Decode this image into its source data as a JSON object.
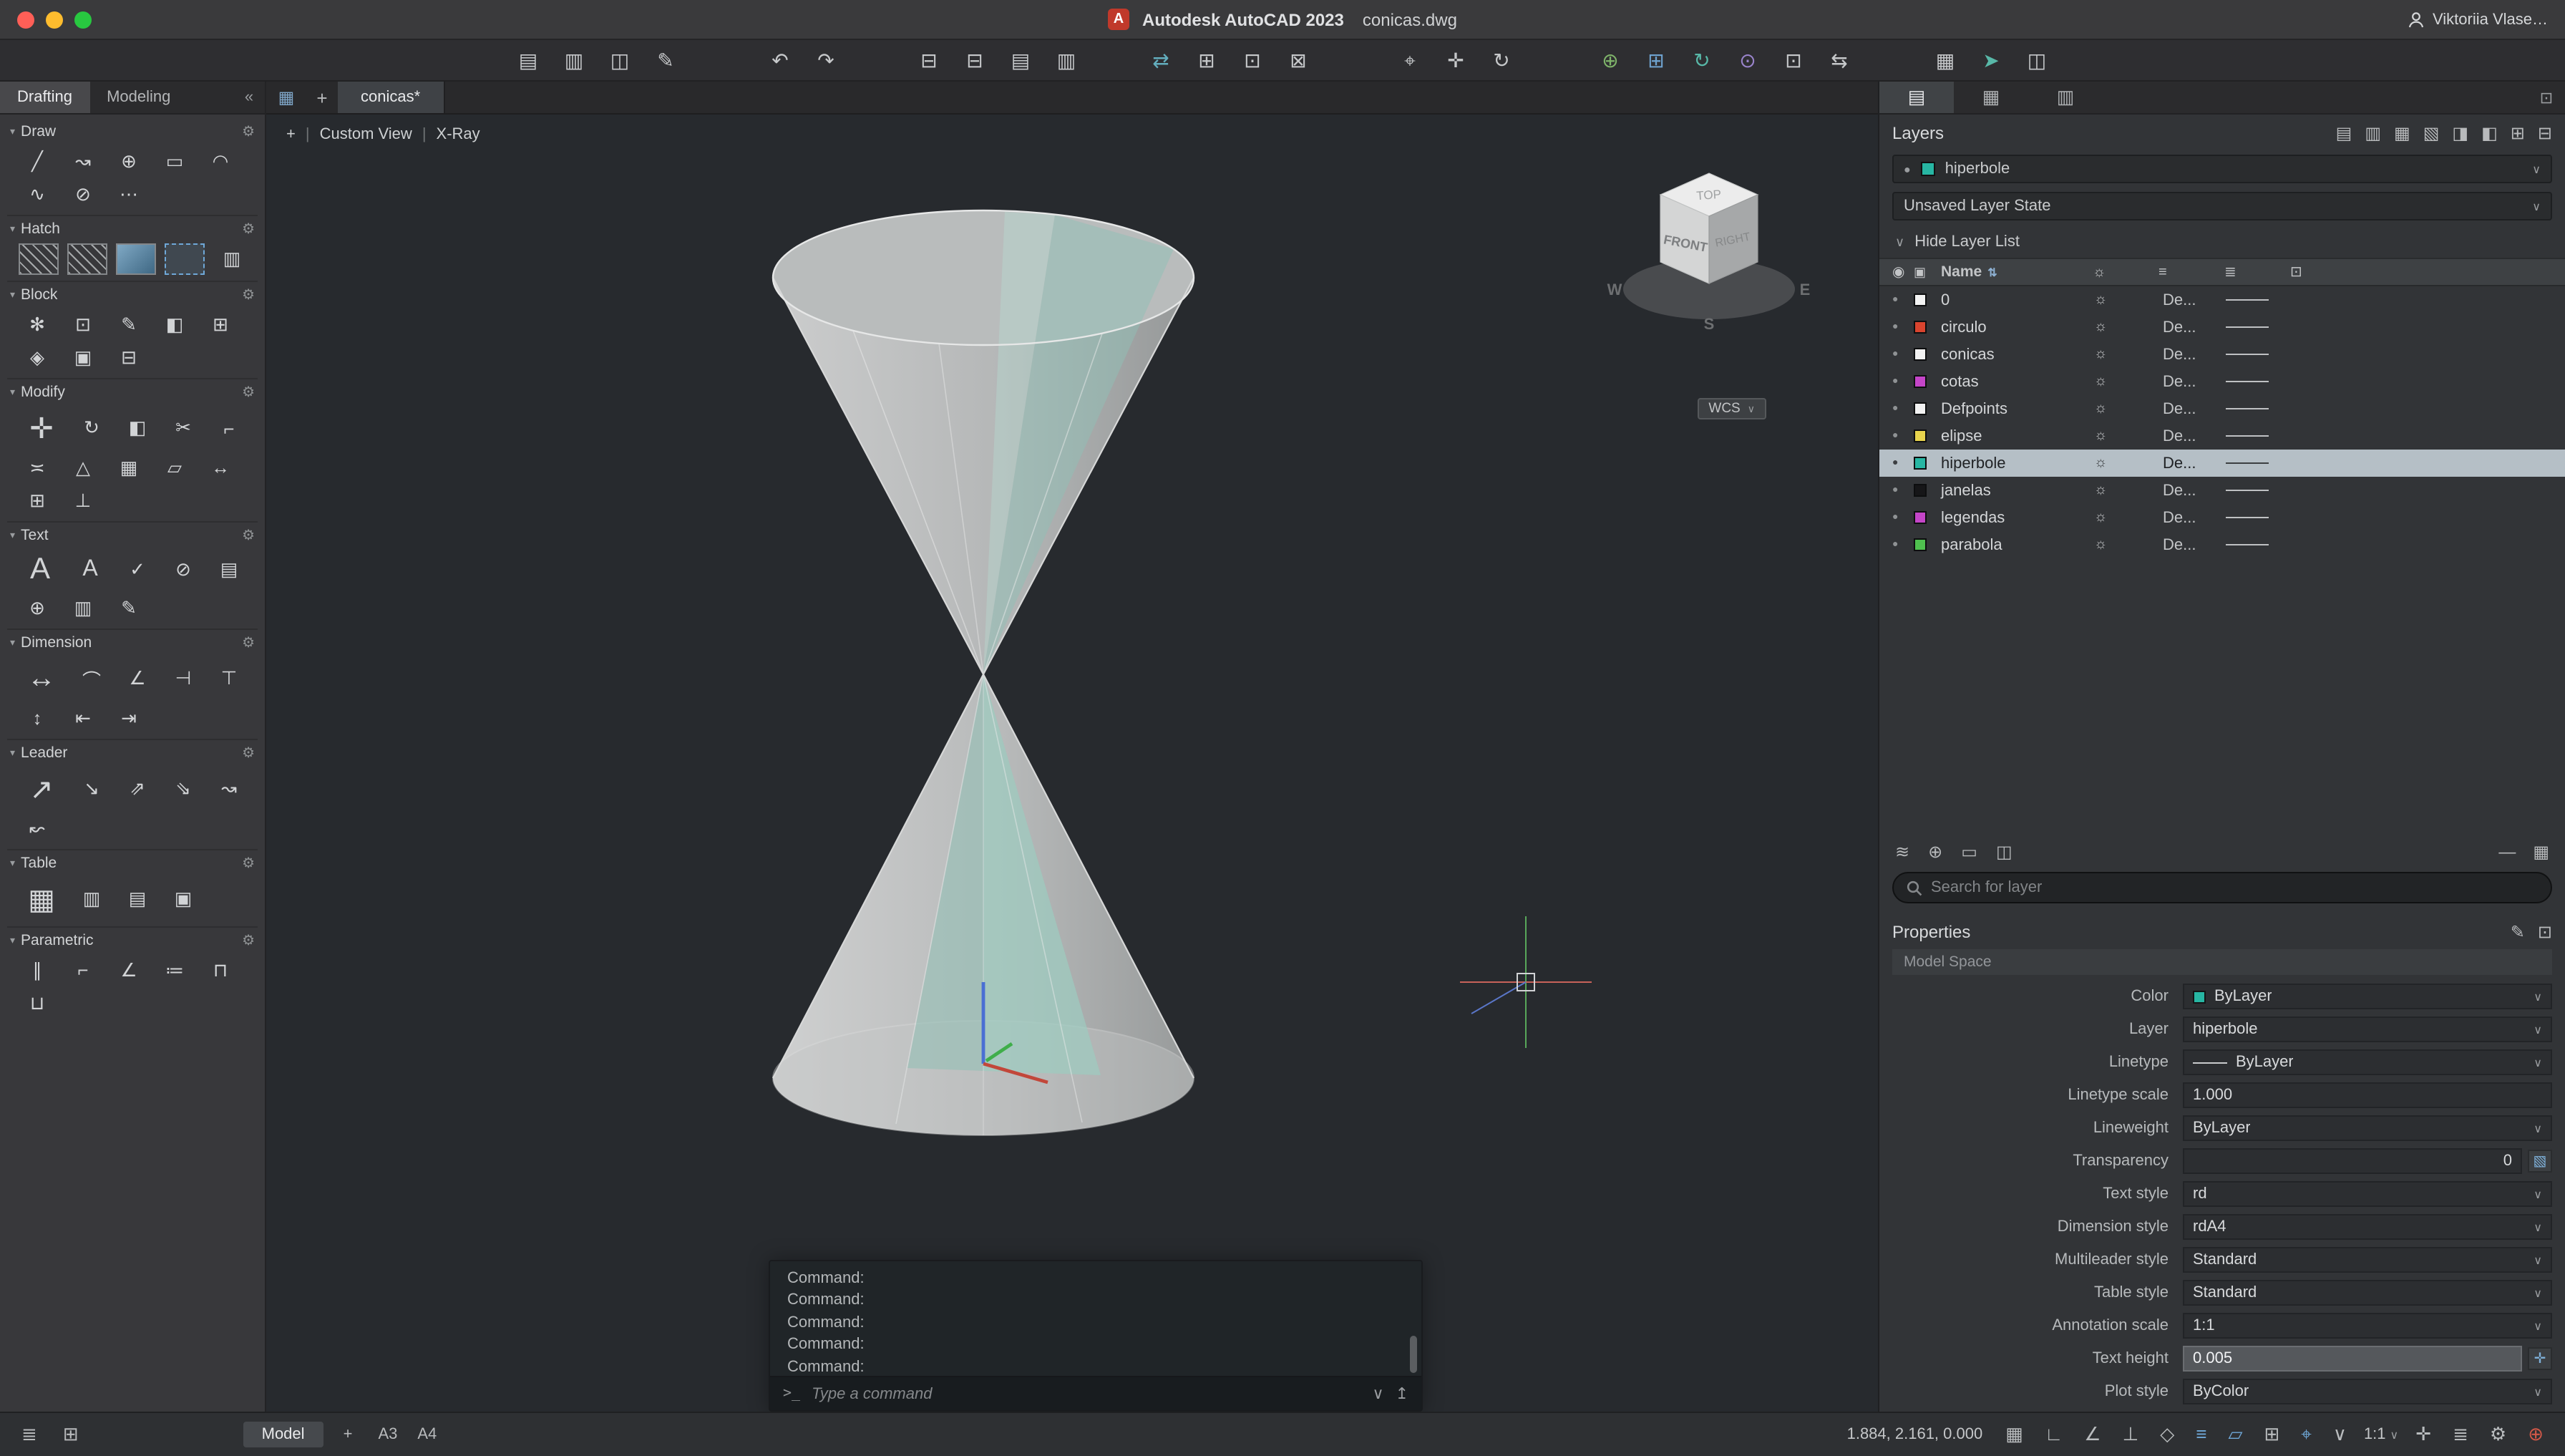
{
  "ui": {
    "arrow": "∨",
    "tri": "▾",
    "gear": "⚙",
    "sep": "|",
    "dot": "●",
    "sun": "☼",
    "eye": "◉",
    "cbox": "▣",
    "sort": "⇅",
    "minus": "—",
    "colgrid": "▦",
    "hist_arrow": "∨",
    "share": "↥",
    "scroll_thumb": ""
  },
  "titlebar": {
    "app_title": "Autodesk AutoCAD 2023",
    "doc_title": "conicas.dwg",
    "user": "Viktoriia Vlase…",
    "badge_letter": "A",
    "lights": [
      "#ff5f57",
      "#febc2e",
      "#28c840"
    ]
  },
  "toolbar": {
    "g1": [
      {
        "g": "▤"
      },
      {
        "g": "▥"
      },
      {
        "g": "◫"
      },
      {
        "g": "✎"
      }
    ],
    "g2": [
      {
        "g": "↶"
      },
      {
        "g": "↷"
      }
    ],
    "g3": [
      {
        "g": "⊟"
      },
      {
        "g": "⊟",
        "badge": "#e2862a"
      },
      {
        "g": "▤",
        "badge": "#e2862a"
      },
      {
        "g": "▥"
      }
    ],
    "g4": [
      {
        "g": "⇄",
        "c": "#63aebe"
      },
      {
        "g": "⊞"
      },
      {
        "g": "⊡"
      },
      {
        "g": "⊠"
      }
    ],
    "g5": [
      {
        "g": "⌖"
      },
      {
        "g": "✛"
      },
      {
        "g": "↻"
      }
    ],
    "g6": [
      {
        "g": "⊕",
        "c": "#7fb46a"
      },
      {
        "g": "⊞",
        "c": "#6fa3d0"
      },
      {
        "g": "↻",
        "c": "#58b8a8"
      },
      {
        "g": "⊙",
        "c": "#9a84cc"
      },
      {
        "g": "⊡"
      },
      {
        "g": "⇆"
      }
    ],
    "g7": [
      {
        "g": "▦"
      },
      {
        "g": "➤",
        "c": "#58b8a8"
      },
      {
        "g": "◫",
        "badge": "#e2862a"
      }
    ]
  },
  "palette": {
    "tabs": [
      {
        "label": "Drafting",
        "cls": "active"
      },
      {
        "label": "Modeling"
      }
    ],
    "collapse": "«",
    "sections": [
      {
        "title": "Draw",
        "icons": [
          {
            "g": "╱"
          },
          {
            "g": "↝"
          },
          {
            "g": "⊕"
          },
          {
            "g": "▭"
          },
          {
            "g": "◠"
          },
          {
            "g": "∿"
          },
          {
            "g": "⊘"
          },
          {
            "g": "⋯"
          }
        ]
      },
      {
        "title": "Hatch",
        "icons": [
          {
            "g": " ",
            "cls": "hatch"
          },
          {
            "g": " ",
            "cls": "hatch"
          },
          {
            "g": " ",
            "cls": "hatch2"
          },
          {
            "g": " ",
            "cls": "hatch3"
          },
          {
            "g": "▥"
          }
        ]
      },
      {
        "title": "Block",
        "icons": [
          {
            "g": "✻"
          },
          {
            "g": "⊡"
          },
          {
            "g": "✎"
          },
          {
            "g": "◧"
          },
          {
            "g": "⊞"
          },
          {
            "g": "◈"
          },
          {
            "g": "▣"
          },
          {
            "g": "⊟"
          }
        ]
      },
      {
        "title": "Modify",
        "icons": [
          {
            "g": "✛",
            "cls": "big2"
          },
          {
            "g": "↻"
          },
          {
            "g": "◧"
          },
          {
            "g": "✂"
          },
          {
            "g": "⌐"
          },
          {
            "g": "≍"
          },
          {
            "g": "△"
          },
          {
            "g": "▦"
          },
          {
            "g": "▱"
          },
          {
            "g": "↔"
          },
          {
            "g": "⊞"
          },
          {
            "g": "⊥"
          }
        ]
      },
      {
        "title": "Text",
        "icons": [
          {
            "g": "A",
            "cls": "bigA"
          },
          {
            "g": "A",
            "cls": "bigA2"
          },
          {
            "g": "✓"
          },
          {
            "g": "⊘"
          },
          {
            "g": "▤"
          },
          {
            "g": "⊕"
          },
          {
            "g": "▥"
          },
          {
            "g": "✎"
          }
        ]
      },
      {
        "title": "Dimension",
        "icons": [
          {
            "g": "↔",
            "cls": "big2"
          },
          {
            "g": "⌒"
          },
          {
            "g": "∠"
          },
          {
            "g": "⊣"
          },
          {
            "g": "⊤"
          },
          {
            "g": "↕"
          },
          {
            "g": "⇤"
          },
          {
            "g": "⇥"
          }
        ]
      },
      {
        "title": "Leader",
        "icons": [
          {
            "g": "↗",
            "cls": "big2"
          },
          {
            "g": "↘"
          },
          {
            "g": "⇗"
          },
          {
            "g": "⇘"
          },
          {
            "g": "↝"
          },
          {
            "g": "↜"
          }
        ]
      },
      {
        "title": "Table",
        "icons": [
          {
            "g": "▦",
            "cls": "big2"
          },
          {
            "g": "▥"
          },
          {
            "g": "▤"
          },
          {
            "g": "▣"
          }
        ]
      },
      {
        "title": "Parametric",
        "icons": [
          {
            "g": "∥"
          },
          {
            "g": "⌐"
          },
          {
            "g": "∠"
          },
          {
            "g": "≔"
          },
          {
            "g": "⊓"
          },
          {
            "g": "⊔"
          }
        ]
      }
    ]
  },
  "doc_tabs": {
    "grid": "▦",
    "plus": "+",
    "tabs": [
      {
        "label": "conicas*",
        "cls": "active"
      }
    ]
  },
  "viewport": {
    "plus": "+",
    "view_name": "Custom View",
    "style": "X-Ray",
    "viewcube": {
      "top": "TOP",
      "front": "FRONT",
      "right": "RIGHT",
      "w": "W",
      "s": "S",
      "e": "E"
    },
    "wcs": "WCS",
    "command": {
      "history": [
        {
          "t": "Command:"
        },
        {
          "t": "Command:"
        },
        {
          "t": "Command:"
        },
        {
          "t": "Command:"
        },
        {
          "t": "Command:"
        }
      ],
      "prompt": ">_",
      "placeholder": "Type a command"
    }
  },
  "right_panel": {
    "tabs": [
      {
        "g": "▤",
        "cls": "active"
      },
      {
        "g": "▦"
      },
      {
        "g": "▥"
      }
    ],
    "pin": "⊡"
  },
  "layers_panel": {
    "title": "Layers",
    "header_icons": [
      {
        "g": "▤"
      },
      {
        "g": "▥"
      },
      {
        "g": "▦"
      },
      {
        "g": "▧"
      },
      {
        "g": "◨"
      },
      {
        "g": "◧"
      },
      {
        "g": "⊞"
      },
      {
        "g": "⊟"
      }
    ],
    "current": {
      "name": "hiperbole",
      "color": "#27b6a3"
    },
    "state": "Unsaved Layer State",
    "hide": "Hide Layer List",
    "name_col": "Name",
    "head_cols": [
      {
        "g": "☼"
      },
      {
        "g": "≡"
      },
      {
        "g": "≣"
      },
      {
        "g": "⊡"
      }
    ],
    "layers": [
      {
        "name": "0",
        "color": "#f2f2f2",
        "lt": "De..."
      },
      {
        "name": "circulo",
        "color": "#d9442e",
        "lt": "De..."
      },
      {
        "name": "conicas",
        "color": "#f2f2f2",
        "lt": "De..."
      },
      {
        "name": "cotas",
        "color": "#c445c8",
        "lt": "De..."
      },
      {
        "name": "Defpoints",
        "color": "#f2f2f2",
        "lt": "De..."
      },
      {
        "name": "elipse",
        "color": "#e8d44d",
        "lt": "De..."
      },
      {
        "name": "hiperbole",
        "color": "#27b6a3",
        "lt": "De...",
        "cls": "selected"
      },
      {
        "name": "janelas",
        "color": "#161618",
        "lt": "De..."
      },
      {
        "name": "legendas",
        "color": "#c445c8",
        "lt": "De..."
      },
      {
        "name": "parabola",
        "color": "#4fc04f",
        "lt": "De..."
      }
    ],
    "footer_icons": [
      {
        "g": "≋"
      },
      {
        "g": "⊕"
      },
      {
        "g": "▭"
      },
      {
        "g": "◫"
      }
    ],
    "minimize": "—",
    "columns_icon": "▦",
    "search_placeholder": "Search for layer"
  },
  "properties_panel": {
    "title": "Properties",
    "head_icons": [
      {
        "g": "✎"
      },
      {
        "g": "⊡"
      }
    ],
    "space": "Model Space",
    "rows": [
      {
        "label": "Color",
        "value": "ByLayer",
        "swatch": "#27b6a3",
        "dropdown": true
      },
      {
        "label": "Layer",
        "value": "hiperbole",
        "dropdown": true
      },
      {
        "label": "Linetype",
        "value": "ByLayer",
        "line": true,
        "dropdown": true
      },
      {
        "label": "Linetype scale",
        "value": "1.000"
      },
      {
        "label": "Lineweight",
        "value": "ByLayer",
        "dropdown": true
      },
      {
        "label": "Transparency",
        "value": "0",
        "cls": "num",
        "btn": "▧"
      },
      {
        "label": "Text style",
        "value": "rd",
        "dropdown": true
      },
      {
        "label": "Dimension style",
        "value": "rdA4",
        "dropdown": true
      },
      {
        "label": "Multileader style",
        "value": "Standard",
        "dropdown": true
      },
      {
        "label": "Table style",
        "value": "Standard",
        "dropdown": true
      },
      {
        "label": "Annotation scale",
        "value": "1:1",
        "dropdown": true
      },
      {
        "label": "Text height",
        "value": "0.005",
        "cls": "hot",
        "btn": "✛"
      },
      {
        "label": "Plot style",
        "value": "ByColor",
        "dropdown": true
      }
    ]
  },
  "statusbar": {
    "left_icons": [
      {
        "g": "≣"
      },
      {
        "g": "⊞"
      }
    ],
    "model": "Model",
    "plus": "+",
    "layouts": [
      {
        "label": "A3"
      },
      {
        "label": "A4"
      }
    ],
    "coords": "1.884, 2.161, 0.000",
    "icons_a": [
      {
        "g": "▦",
        "c": "#b9bcbe"
      },
      {
        "g": "∟",
        "c": "#b9bcbe"
      },
      {
        "g": "∠",
        "c": "#b9bcbe"
      },
      {
        "g": "⊥",
        "c": "#b9bcbe"
      },
      {
        "g": "◇",
        "c": "#b9bcbe"
      },
      {
        "g": "≡",
        "c": "#6fa8d8"
      },
      {
        "g": "▱",
        "c": "#6fa8d8"
      },
      {
        "g": "⊞",
        "c": "#b9bcbe"
      },
      {
        "g": "⌖",
        "c": "#6fa8d8"
      },
      {
        "g": "∨",
        "c": "#b9bcbe"
      }
    ],
    "scale": "1:1",
    "icons_b": [
      {
        "g": "✛",
        "c": "#b9bcbe"
      },
      {
        "g": "≣",
        "c": "#b9bcbe"
      },
      {
        "g": "⚙",
        "c": "#b9bcbe"
      },
      {
        "g": "⊕",
        "c": "#d05848"
      }
    ]
  }
}
